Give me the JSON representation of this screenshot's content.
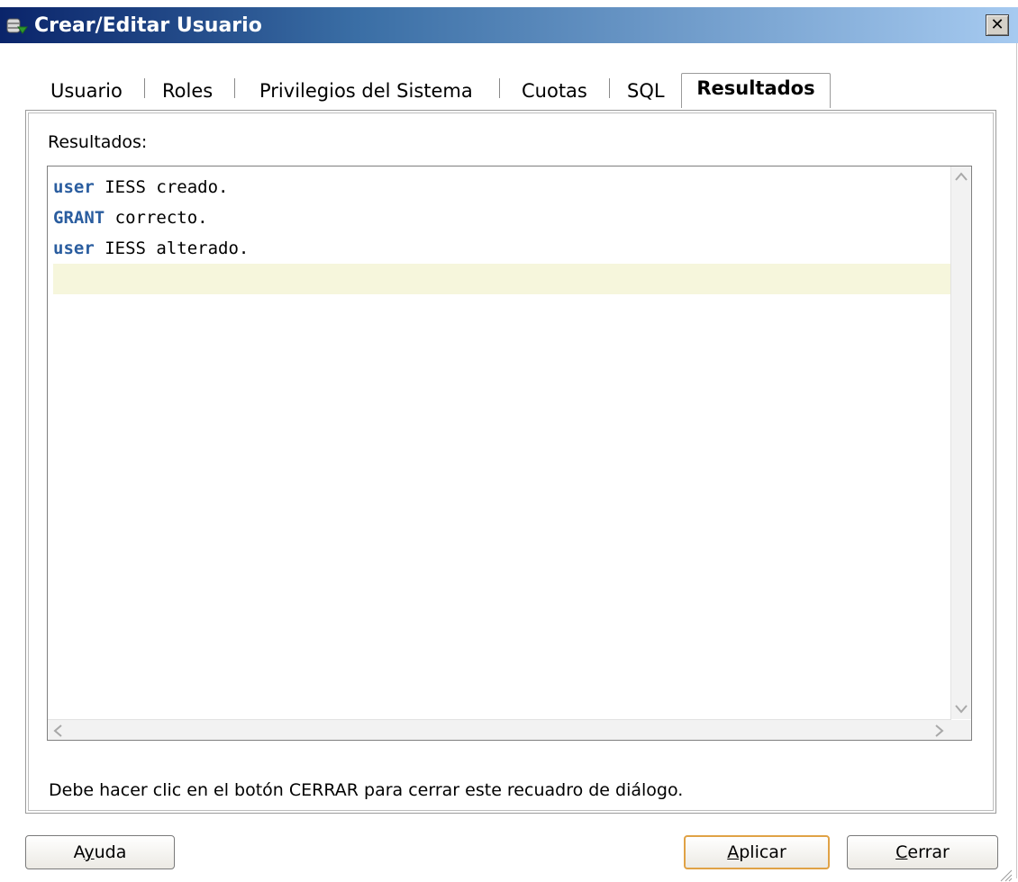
{
  "window": {
    "title": "Crear/Editar Usuario",
    "close_glyph": "✕"
  },
  "tabs": [
    {
      "label": "Usuario",
      "active": false
    },
    {
      "label": "Roles",
      "active": false
    },
    {
      "label": "Privilegios del Sistema",
      "active": false
    },
    {
      "label": "Cuotas",
      "active": false
    },
    {
      "label": "SQL",
      "active": false
    },
    {
      "label": "Resultados",
      "active": true
    }
  ],
  "results": {
    "label": "Resultados:",
    "lines": [
      {
        "keyword": "user",
        "text": " IESS creado."
      },
      {
        "keyword": "GRANT",
        "text": " correcto."
      },
      {
        "keyword": "user",
        "text": " IESS alterado."
      }
    ]
  },
  "footer": {
    "message": "Debe hacer clic en el botón CERRAR para cerrar este recuadro de diálogo."
  },
  "buttons": {
    "help": {
      "pre": "A",
      "mnemonic": "y",
      "post": "uda"
    },
    "apply": {
      "pre": "",
      "mnemonic": "A",
      "post": "plicar"
    },
    "close": {
      "pre": "",
      "mnemonic": "C",
      "post": "errar"
    }
  },
  "colors": {
    "keyword": "#2a5d9f",
    "current_line": "#f6f6dc",
    "default_button_border": "#e0a246",
    "titlebar_start": "#0a246a",
    "titlebar_end": "#a6caf0"
  },
  "icons": {
    "title": "database-user-icon",
    "close": "close-icon",
    "resize": "resize-grip-icon"
  }
}
